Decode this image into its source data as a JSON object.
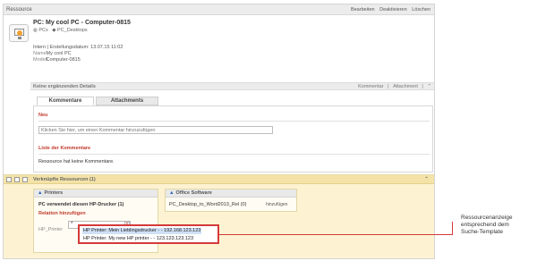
{
  "window": {
    "title": "Ressource",
    "actions": [
      "Bearbeiten",
      "Deaktivieren",
      "Löschen"
    ]
  },
  "resource": {
    "title": "PC: My cool PC - Computer-0815",
    "tags": [
      "PCs",
      "PC_Desktops"
    ],
    "meta_line": "Intern | Erstellungsdatum: 13.07.15 11:02",
    "name_label": "Name",
    "name_value": "My cool PC",
    "model_label": "Modell",
    "model_value": "Computer-0815"
  },
  "details_bar": {
    "label": "Keine ergänzenden Details",
    "actions": [
      "Kommentar",
      "Attachment"
    ]
  },
  "tabs": [
    "Kommentare",
    "Attachments"
  ],
  "comments": {
    "new_heading": "Neu",
    "input_placeholder": "Klicken Sie hier, um einen Kommentar hinzuzufügen",
    "list_heading": "Liste der Kommentare",
    "empty_text": "Ressource hat keine Kommentare."
  },
  "linked": {
    "label": "Verknüpfte Ressourcen (1)",
    "printers": {
      "header": "Printers",
      "uses_text": "PC verwendet diesen HP-Drucker (1)",
      "relation_add": "Relation hinzufügen",
      "field_label": "HP_Printer",
      "field_value": "*"
    },
    "office": {
      "header": "Office Software",
      "item": "PC_Desktop_to_Word2013_Rel (0)",
      "assign": "hinzufügen"
    }
  },
  "dropdown": {
    "items": [
      "HP Printer: Mein Lieblingsdrucker - - 192.168.123.123",
      "HP Printer: My new HP printer - - 123.123.123.123"
    ]
  },
  "callout": {
    "lines": [
      "Ressourcenanzeige",
      "entsprechend dem",
      "Suche-Template"
    ]
  },
  "colors": {
    "accent_red": "#d43a3a",
    "linked_bg": "#fdf3d2",
    "highlight": "#cfe0f5"
  }
}
